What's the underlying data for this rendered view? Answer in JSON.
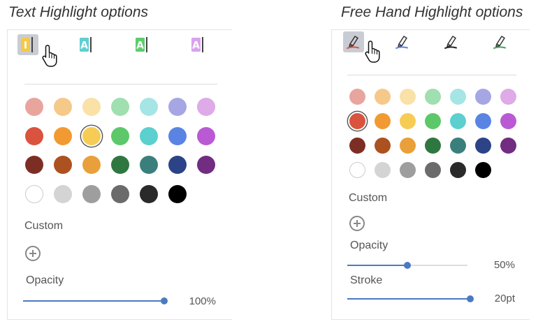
{
  "text_section": {
    "title": "Text Highlight options",
    "tools": [
      {
        "name": "text-highlight-yellow",
        "color": "#f5c84a",
        "selected": true
      },
      {
        "name": "text-highlight-teal",
        "color": "#5fcfd2",
        "selected": false
      },
      {
        "name": "text-highlight-green",
        "color": "#5ccd6e",
        "selected": false
      },
      {
        "name": "text-highlight-purple",
        "color": "#d9a3ec",
        "selected": false
      }
    ],
    "palette": [
      [
        "#e8a59d",
        "#f5c98a",
        "#f9e1a7",
        "#9fdfb0",
        "#a6e5e6",
        "#a6a6e5",
        "#deaae8"
      ],
      [
        "#d9533f",
        "#f19a32",
        "#f7cc55",
        "#5cc86a",
        "#5ccfcf",
        "#5a84e4",
        "#b95ad4"
      ],
      [
        "#7d2e24",
        "#ac5120",
        "#e9a03a",
        "#2f7740",
        "#3b7f7d",
        "#2c4387",
        "#712d82"
      ],
      [
        "#ffffff",
        "#d4d4d4",
        "#9e9e9e",
        "#6b6b6b",
        "#2a2a2a",
        "#000000"
      ]
    ],
    "selected_swatch": {
      "row": 1,
      "col": 2
    },
    "custom_label": "Custom",
    "opacity_label": "Opacity",
    "opacity_value": "100%",
    "opacity_fraction": 1.0
  },
  "free_section": {
    "title": "Free Hand Highlight options",
    "tools": [
      {
        "name": "freehand-pen-red",
        "color": "#d9533f",
        "selected": true
      },
      {
        "name": "freehand-pen-blue",
        "color": "#5a84e4",
        "selected": false
      },
      {
        "name": "freehand-pen-black",
        "color": "#222222",
        "selected": false
      },
      {
        "name": "freehand-pen-green",
        "color": "#3aa55a",
        "selected": false
      }
    ],
    "palette": [
      [
        "#e8a59d",
        "#f5c98a",
        "#f9e1a7",
        "#9fdfb0",
        "#a6e5e6",
        "#a6a6e5",
        "#deaae8"
      ],
      [
        "#d9533f",
        "#f19a32",
        "#f7cc55",
        "#5cc86a",
        "#5ccfcf",
        "#5a84e4",
        "#b95ad4"
      ],
      [
        "#7d2e24",
        "#ac5120",
        "#e9a03a",
        "#2f7740",
        "#3b7f7d",
        "#2c4387",
        "#712d82"
      ],
      [
        "#ffffff",
        "#d4d4d4",
        "#9e9e9e",
        "#6b6b6b",
        "#2a2a2a",
        "#000000"
      ]
    ],
    "selected_swatch": {
      "row": 1,
      "col": 0
    },
    "custom_label": "Custom",
    "opacity_label": "Opacity",
    "opacity_value": "50%",
    "opacity_fraction": 0.5,
    "stroke_label": "Stroke",
    "stroke_value": "20pt",
    "stroke_fraction": 1.0
  },
  "colors": {
    "slider_accent": "#4a7ac0"
  }
}
